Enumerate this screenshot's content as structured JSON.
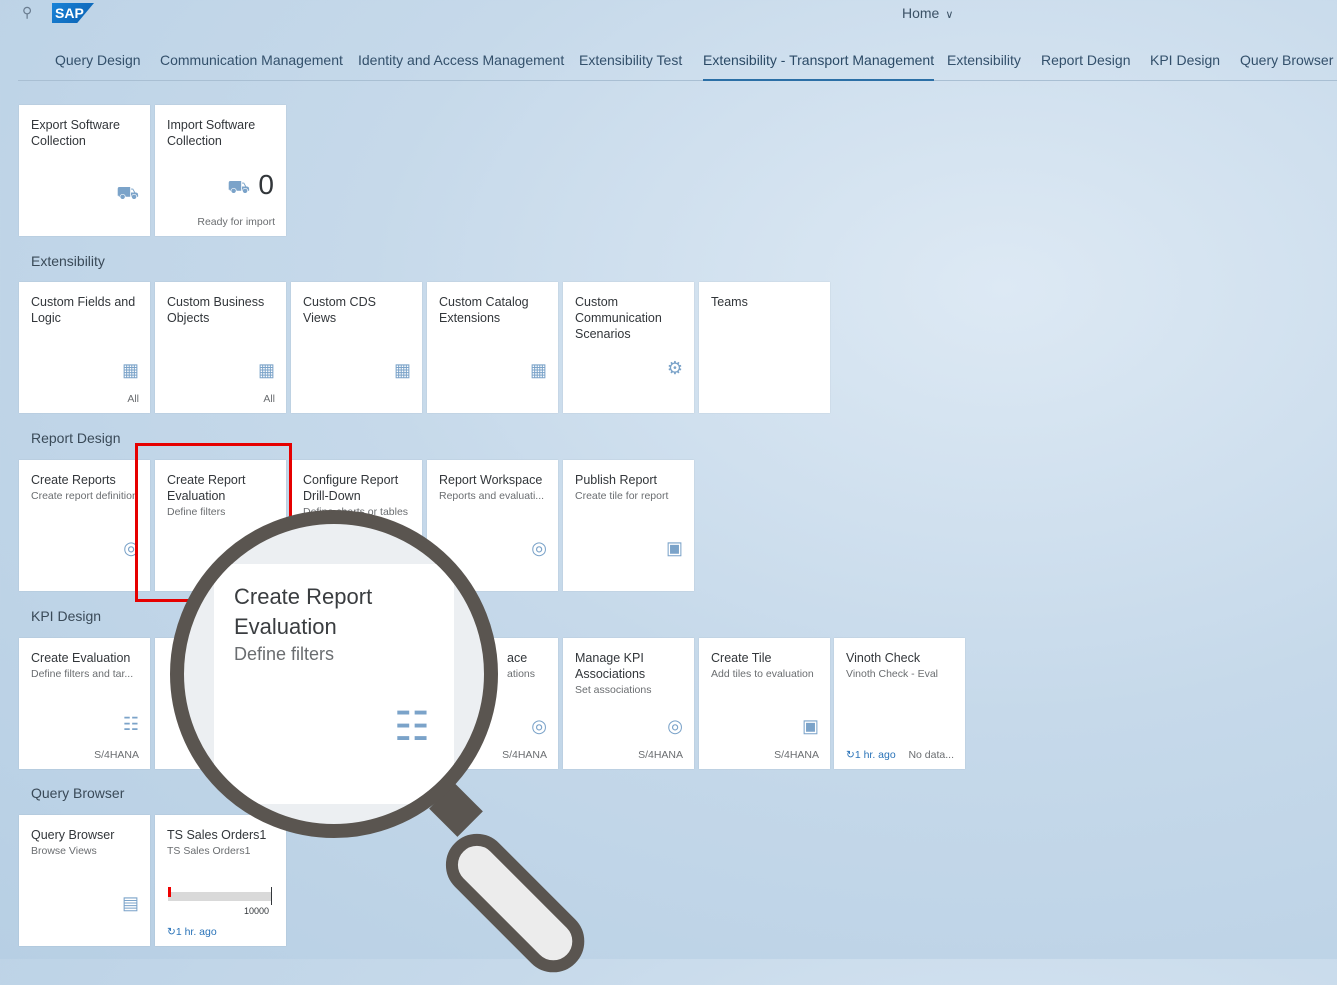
{
  "header": {
    "logo": "SAP",
    "home_label": "Home",
    "home_chevron": "∨"
  },
  "tabs": [
    {
      "label": "Query Design"
    },
    {
      "label": "Communication Management"
    },
    {
      "label": "Identity and Access Management"
    },
    {
      "label": "Extensibility Test"
    },
    {
      "label": "Extensibility - Transport Management"
    },
    {
      "label": "Extensibility"
    },
    {
      "label": "Report Design"
    },
    {
      "label": "KPI Design"
    },
    {
      "label": "Query Browser"
    }
  ],
  "transport": [
    {
      "title": "Export Software Collection",
      "icon": "truck-icon"
    },
    {
      "title": "Import Software Collection",
      "icon": "truck-icon",
      "number": "0",
      "footer": "Ready for import"
    }
  ],
  "sections": {
    "extensibility": "Extensibility",
    "report_design": "Report Design",
    "kpi_design": "KPI Design",
    "query_browser": "Query Browser"
  },
  "extensibility_tiles": [
    {
      "title": "Custom Fields and Logic",
      "footer": "All",
      "icon": "puzzle-icon"
    },
    {
      "title": "Custom Business Objects",
      "footer": "All",
      "icon": "puzzle-icon"
    },
    {
      "title": "Custom CDS Views",
      "icon": "grid-icon"
    },
    {
      "title": "Custom Catalog Extensions",
      "icon": "puzzle-icon"
    },
    {
      "title": "Custom Communication Scenarios",
      "icon": "gear-icon"
    },
    {
      "title": "Teams"
    }
  ],
  "report_tiles": [
    {
      "title": "Create Reports",
      "subtitle": "Create report definition",
      "icon": "target-icon"
    },
    {
      "title": "Create Report Evaluation",
      "subtitle": "Define filters"
    },
    {
      "title": "Configure Report Drill-Down",
      "subtitle": "Define charts or tables"
    },
    {
      "title": "Report Workspace",
      "subtitle": "Reports and evaluati...",
      "icon": "target-icon"
    },
    {
      "title": "Publish Report",
      "subtitle": "Create tile for report",
      "icon": "tile-icon"
    }
  ],
  "kpi_tiles": [
    {
      "title": "Create Evaluation",
      "subtitle": "Define filters and tar...",
      "footer": "S/4HANA",
      "icon": "clipboard-add-icon"
    },
    {
      "title": "ace",
      "subtitle": "ations",
      "footer": "S/4HANA",
      "icon": "target-icon"
    },
    {
      "title": "Manage KPI Associations",
      "subtitle": "Set associations",
      "footer": "S/4HANA",
      "icon": "target-icon"
    },
    {
      "title": "Create Tile",
      "subtitle": "Add tiles to evaluation",
      "footer": "S/4HANA",
      "icon": "tile-icon"
    },
    {
      "title": "Vinoth Check",
      "subtitle": "Vinoth Check - Eval",
      "refresh": "1 hr. ago",
      "footer": "No data..."
    }
  ],
  "query_tiles": [
    {
      "title": "Query Browser",
      "subtitle": "Browse Views",
      "icon": "monitor-icon"
    },
    {
      "title": "TS Sales Orders1",
      "subtitle": "TS Sales Orders1",
      "bar_label": "10000",
      "refresh": "1 hr. ago"
    }
  ],
  "magnifier": {
    "title": "Create Report Evaluation",
    "subtitle": "Define filters"
  }
}
